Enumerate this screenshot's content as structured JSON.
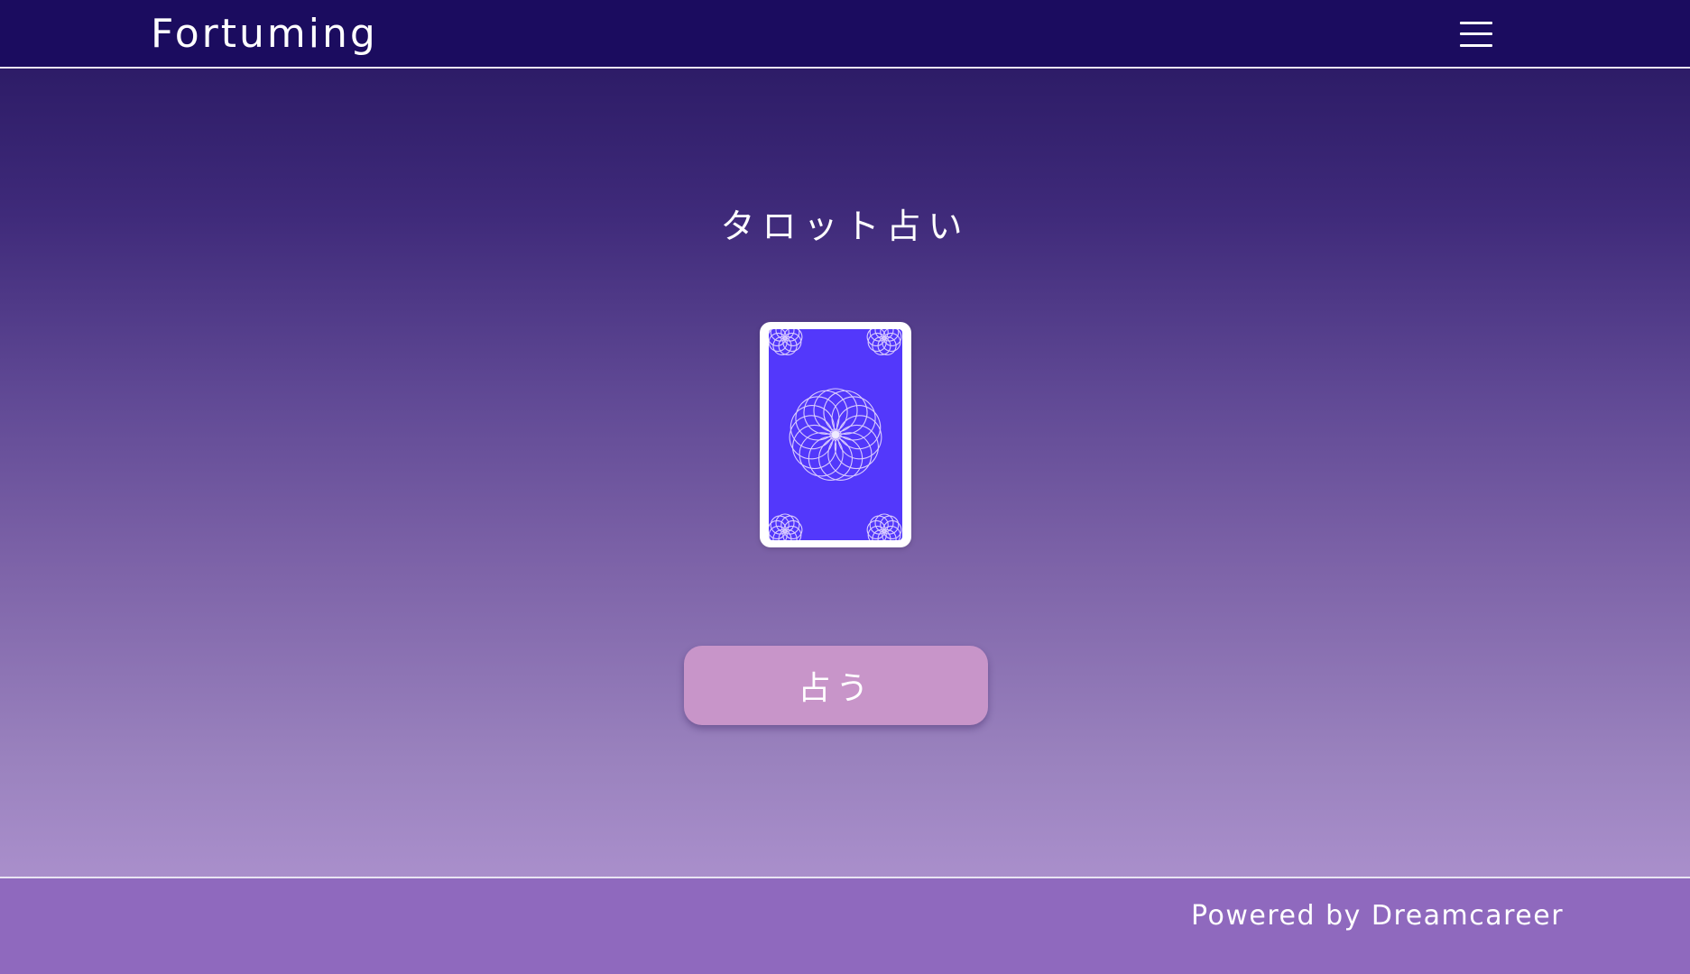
{
  "header": {
    "brand": "Fortuming",
    "menu_icon": "hamburger-menu-icon"
  },
  "main": {
    "title": "タロット占い",
    "card_icon": "tarot-card-back-icon",
    "button_label": "占う"
  },
  "footer": {
    "credit": "Powered by Dreamcareer"
  },
  "colors": {
    "header_bg": "#1b0c5f",
    "card_face": "#5338fb",
    "button_bg": "#c895c9",
    "footer_bg": "#8f69be"
  }
}
